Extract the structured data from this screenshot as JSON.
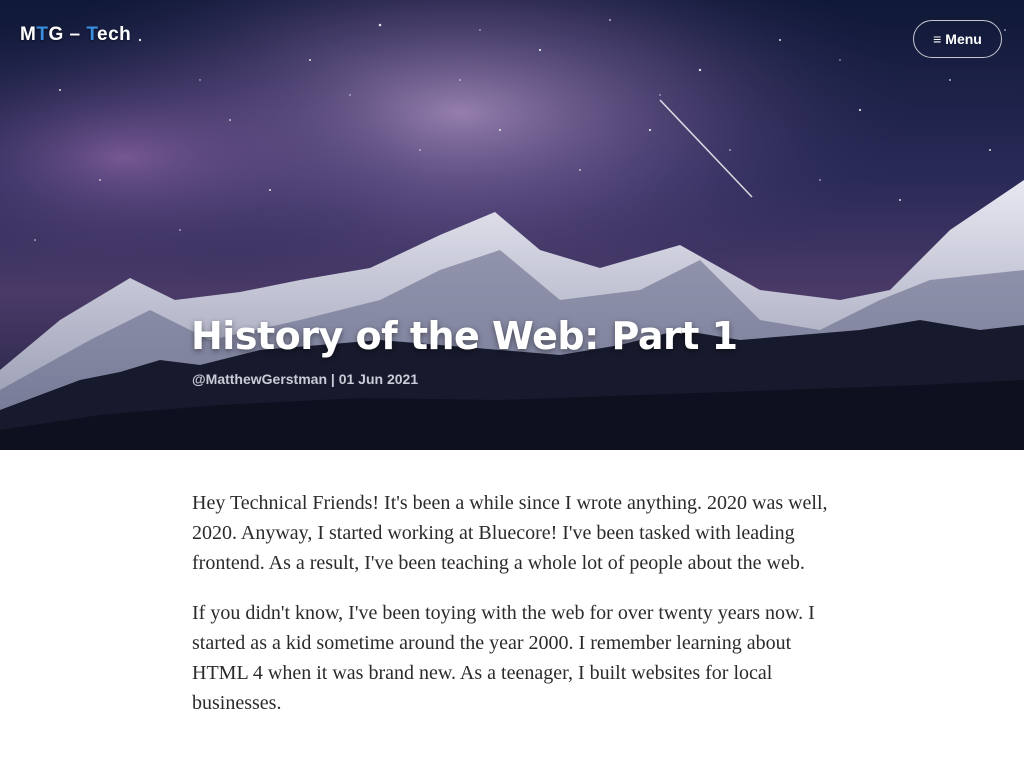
{
  "header": {
    "logo_part1": "M",
    "logo_accent1": "T",
    "logo_part2": "G – ",
    "logo_accent2": "T",
    "logo_part3": "ech",
    "menu_icon": "hamburger-icon",
    "menu_label": "Menu"
  },
  "post": {
    "title": "History of the Web: Part 1",
    "author": "@MatthewGerstman",
    "separator": "|",
    "date": "01 Jun 2021",
    "paragraphs": [
      "Hey Technical Friends! It's been a while since I wrote anything. 2020 was well, 2020. Anyway, I started working at Bluecore! I've been tasked with leading frontend. As a result, I've been teaching a whole lot of people about the web.",
      "If you didn't know, I've been toying with the web for over twenty years now. I started as a kid sometime around the year 2000. I remember learning about HTML 4 when it was brand new. As a teenager, I built websites for local businesses."
    ]
  },
  "colors": {
    "logo_accent": "#3a8fe0",
    "body_text": "#2b2b2b",
    "meta_text": "#c9ccd6"
  }
}
